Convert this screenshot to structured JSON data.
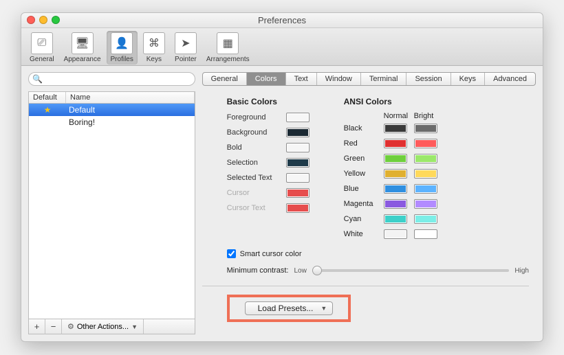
{
  "window": {
    "title": "Preferences"
  },
  "toolbar": {
    "items": [
      {
        "label": "General"
      },
      {
        "label": "Appearance"
      },
      {
        "label": "Profiles"
      },
      {
        "label": "Keys"
      },
      {
        "label": "Pointer"
      },
      {
        "label": "Arrangements"
      }
    ]
  },
  "sidebar": {
    "search_placeholder": "",
    "headers": {
      "c1": "Default",
      "c2": "Name"
    },
    "rows": [
      {
        "name": "Default",
        "starred": true,
        "selected": true
      },
      {
        "name": "Boring!",
        "starred": false,
        "selected": false
      }
    ],
    "footer": {
      "plus": "+",
      "minus": "−",
      "actions": "Other Actions..."
    }
  },
  "tabs": [
    "General",
    "Colors",
    "Text",
    "Window",
    "Terminal",
    "Session",
    "Keys",
    "Advanced"
  ],
  "active_tab": "Colors",
  "basic": {
    "title": "Basic Colors",
    "items": [
      {
        "label": "Foreground",
        "color": "#f6f6f6",
        "disabled": false
      },
      {
        "label": "Background",
        "color": "#1b2933",
        "disabled": false
      },
      {
        "label": "Bold",
        "color": "#f6f6f6",
        "disabled": false
      },
      {
        "label": "Selection",
        "color": "#1f3b4a",
        "disabled": false
      },
      {
        "label": "Selected Text",
        "color": "#f6f6f6",
        "disabled": false
      },
      {
        "label": "Cursor",
        "color": "#e64d4d",
        "disabled": true
      },
      {
        "label": "Cursor Text",
        "color": "#e64d4d",
        "disabled": true
      }
    ]
  },
  "ansi": {
    "title": "ANSI Colors",
    "headers": {
      "normal": "Normal",
      "bright": "Bright"
    },
    "rows": [
      {
        "label": "Black",
        "normal": "#3a3a3a",
        "bright": "#6b6b6b"
      },
      {
        "label": "Red",
        "normal": "#e03030",
        "bright": "#ff5b5b"
      },
      {
        "label": "Green",
        "normal": "#6fcf3d",
        "bright": "#9be86a"
      },
      {
        "label": "Yellow",
        "normal": "#e0b030",
        "bright": "#ffd95b"
      },
      {
        "label": "Blue",
        "normal": "#2f8fe0",
        "bright": "#5cb3ff"
      },
      {
        "label": "Magenta",
        "normal": "#8a5ae0",
        "bright": "#b28bff"
      },
      {
        "label": "Cyan",
        "normal": "#3dd0c9",
        "bright": "#7ceee7"
      },
      {
        "label": "White",
        "normal": "#f3f3f3",
        "bright": "#ffffff"
      }
    ]
  },
  "smart_cursor": {
    "label": "Smart cursor color",
    "checked": true
  },
  "contrast": {
    "label": "Minimum contrast:",
    "low": "Low",
    "high": "High"
  },
  "preset_button": "Load Presets..."
}
